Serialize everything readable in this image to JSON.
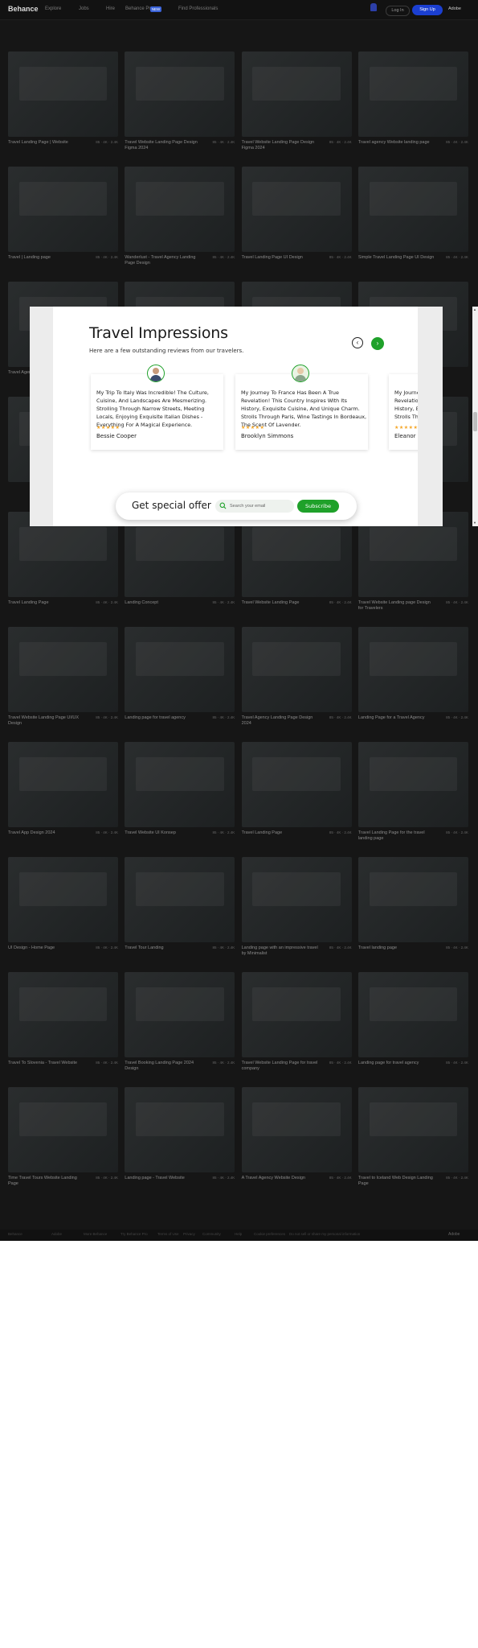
{
  "topbar": {
    "logo": "Behance",
    "nav": [
      "Explore",
      "Jobs",
      "Hire",
      "Behance Pro",
      "Find Professionals"
    ],
    "pro_badge": "NEW",
    "login": "Log In",
    "signup": "Sign Up",
    "adobe": "Adobe"
  },
  "grid": [
    {
      "title": "Travel Landing Page | Website",
      "owner": "",
      "stats": "85 · 4K · 2.4K"
    },
    {
      "title": "Travel Website Landing Page Design Figma 2024",
      "owner": "",
      "stats": "85 · 4K · 2.4K"
    },
    {
      "title": "Travel Website Landing Page Design Figma 2024",
      "owner": "",
      "stats": "85 · 4K · 2.4K"
    },
    {
      "title": "Travel agency Website landing page",
      "owner": "",
      "stats": "85 · 4K · 2.4K"
    },
    {
      "title": "Travel | Landing page",
      "owner": "",
      "stats": "85 · 4K · 2.4K"
    },
    {
      "title": "Wanderlust - Travel Agency Landing Page Design",
      "owner": "",
      "stats": "85 · 4K · 2.4K"
    },
    {
      "title": "Travel Landing Page UI Design",
      "owner": "",
      "stats": "85 · 4K · 2.4K"
    },
    {
      "title": "Simple Travel Landing Page UI Design",
      "owner": "",
      "stats": "85 · 4K · 2.4K"
    },
    {
      "title": "Travel Agency",
      "owner": "",
      "stats": ""
    },
    {
      "title": "",
      "owner": "",
      "stats": ""
    },
    {
      "title": "",
      "owner": "",
      "stats": ""
    },
    {
      "title": "",
      "owner": "",
      "stats": ""
    },
    {
      "title": "",
      "owner": "",
      "stats": ""
    },
    {
      "title": "",
      "owner": "",
      "stats": ""
    },
    {
      "title": "",
      "owner": "",
      "stats": ""
    },
    {
      "title": "",
      "owner": "",
      "stats": ""
    },
    {
      "title": "Travel Landing Page",
      "owner": "",
      "stats": "85 · 4K · 2.4K"
    },
    {
      "title": "Landing Concept",
      "owner": "",
      "stats": "85 · 4K · 2.4K"
    },
    {
      "title": "Travel Website Landing Page",
      "owner": "",
      "stats": "85 · 4K · 2.4K"
    },
    {
      "title": "Travel Website Landing page Design for Travelers",
      "owner": "",
      "stats": "85 · 4K · 2.4K"
    },
    {
      "title": "Travel Website Landing Page UI/UX Design",
      "owner": "",
      "stats": "85 · 4K · 2.4K"
    },
    {
      "title": "Landing page for travel agency",
      "owner": "",
      "stats": "85 · 4K · 2.4K"
    },
    {
      "title": "Travel Agency Landing Page Design 2024",
      "owner": "",
      "stats": "85 · 4K · 2.4K"
    },
    {
      "title": "Landing Page for a Travel Agency",
      "owner": "",
      "stats": "85 · 4K · 2.4K"
    },
    {
      "title": "Travel App Design 2024",
      "owner": "",
      "stats": "85 · 4K · 2.4K"
    },
    {
      "title": "Travel Website UI Konsep",
      "owner": "",
      "stats": "85 · 4K · 2.4K"
    },
    {
      "title": "Travel Landing Page",
      "owner": "",
      "stats": "85 · 4K · 2.4K"
    },
    {
      "title": "Travel Landing Page for the travel landing page",
      "owner": "",
      "stats": "85 · 4K · 2.4K"
    },
    {
      "title": "UI Design - Home Page",
      "owner": "",
      "stats": "85 · 4K · 2.4K"
    },
    {
      "title": "Travel Tour Landing",
      "owner": "",
      "stats": "85 · 4K · 2.4K"
    },
    {
      "title": "Landing page with an impressive travel by Minimalist",
      "owner": "",
      "stats": "85 · 4K · 2.4K"
    },
    {
      "title": "Travel landing page",
      "owner": "",
      "stats": "85 · 4K · 2.4K"
    },
    {
      "title": "Travel To Slovenia - Travel Website",
      "owner": "",
      "stats": "85 · 4K · 2.4K"
    },
    {
      "title": "Travel Booking Landing Page 2024 Design",
      "owner": "",
      "stats": "85 · 4K · 2.4K"
    },
    {
      "title": "Travel Website Landing Page for travel company",
      "owner": "",
      "stats": "85 · 4K · 2.4K"
    },
    {
      "title": "Landing page for travel agency",
      "owner": "",
      "stats": "85 · 4K · 2.4K"
    },
    {
      "title": "Time Travel Tours Website Landing Page",
      "owner": "",
      "stats": "85 · 4K · 2.4K"
    },
    {
      "title": "Landing page - Travel Website",
      "owner": "",
      "stats": "85 · 4K · 2.4K"
    },
    {
      "title": "A Travel Agency Website Design",
      "owner": "",
      "stats": "85 · 4K · 2.4K"
    },
    {
      "title": "Travel to Iceland Web Design Landing Page",
      "owner": "",
      "stats": "85 · 4K · 2.4K"
    }
  ],
  "modal": {
    "heading": "Travel Impressions",
    "subheading": "Here are a few outstanding reviews from our travelers.",
    "prev_icon": "‹",
    "next_icon": "›",
    "reviews": [
      {
        "text": "My Trip To Italy Was Incredible! The Culture, Cuisine, And Landscapes Are Mesmerizing. Strolling Through Narrow Streets, Meeting Locals, Enjoying Exquisite Italian Dishes - Everything For A Magical Experience.",
        "stars": "★★★★★",
        "name": "Bessie Cooper"
      },
      {
        "text": "My Journey To France Has Been A True Revelation! This Country Inspires With Its History, Exquisite Cuisine, And Unique Charm. Strolls Through Paris, Wine Tastings In Bordeaux, The Scent Of Lavender.",
        "stars": "★★★★★",
        "name": "Brooklyn Simmons"
      },
      {
        "text": "My Journey To France Has Been A True Revelation! This Country Inspires With Its History, Exquisite Cuisine, And Unique Charm. Strolls Through Paris, Wine Tastings In Bordeaux.",
        "stars": "★★★★★",
        "name": "Eleanor Pena"
      }
    ],
    "offer": {
      "title": "Get special offer",
      "placeholder": "Search your email",
      "button": "Subscribe"
    }
  },
  "footer": {
    "links": [
      "Behance",
      "Adobe",
      "More Behance",
      "Try Behance Pro",
      "Terms of Use",
      "Privacy",
      "Community",
      "Help",
      "Cookie preferences",
      "Do not sell or share my personal information"
    ],
    "adobe": "Adobe"
  },
  "colors": {
    "accent": "#1fa12a",
    "brand": "#1b3fd1",
    "star": "#f5a524"
  }
}
